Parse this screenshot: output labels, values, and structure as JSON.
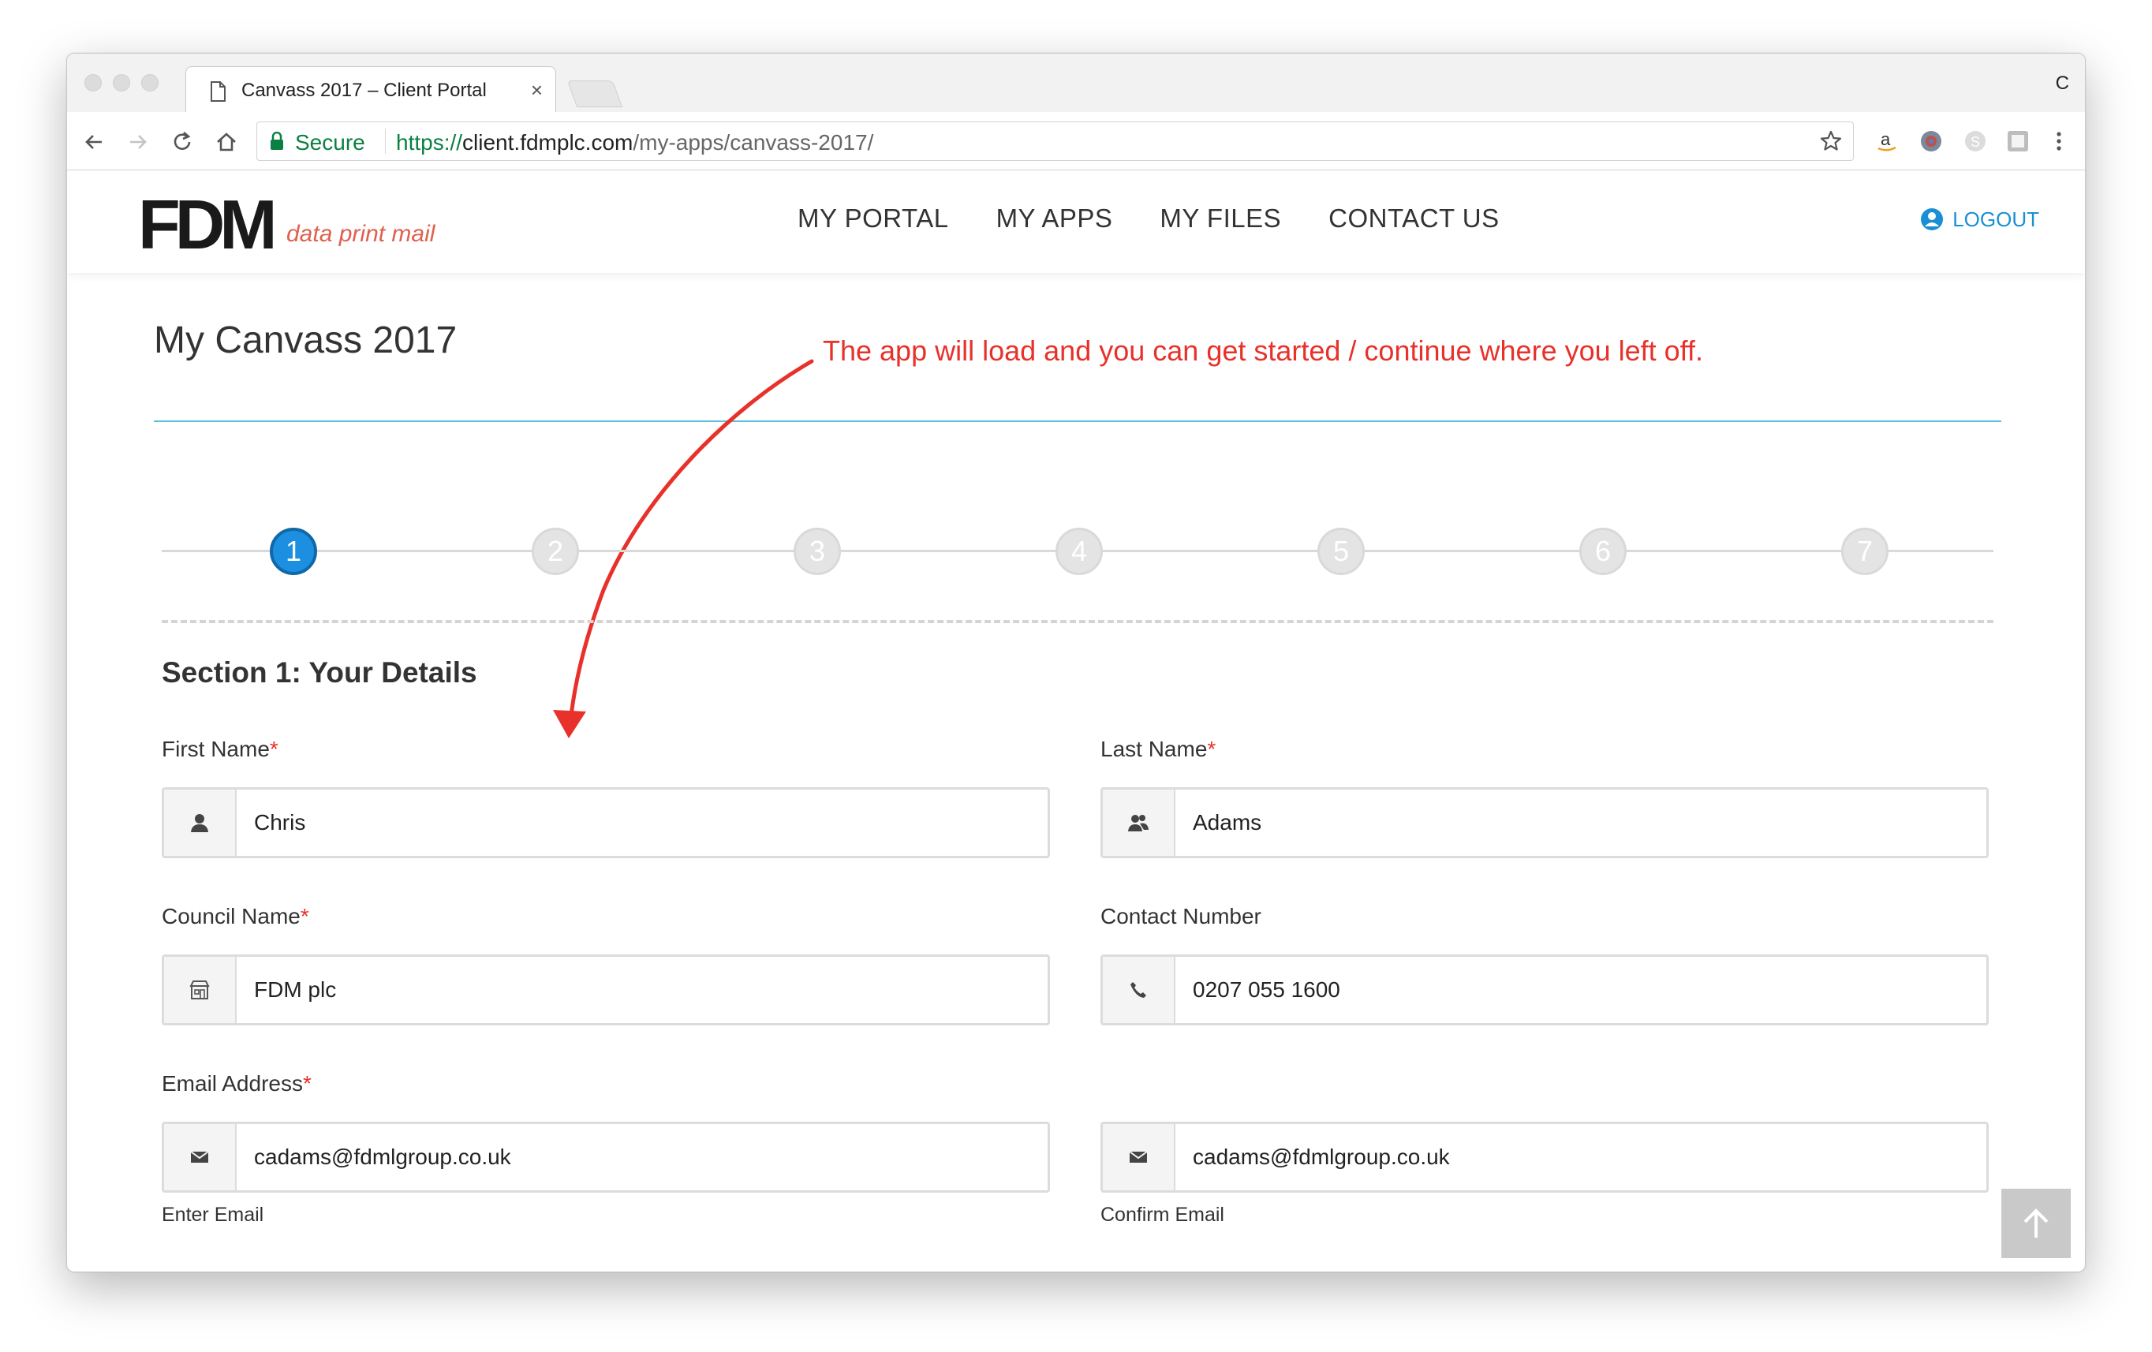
{
  "browser": {
    "tab_title": "Canvass 2017 – Client Portal",
    "tab_close": "×",
    "title_letter": "C",
    "secure_label": "Secure",
    "url_scheme": "https://",
    "url_host": "client.fdmplc.com",
    "url_path": "/my-apps/canvass-2017/"
  },
  "header": {
    "logo_main": "FDM",
    "logo_tagline": "data print mail",
    "nav": [
      "MY PORTAL",
      "MY APPS",
      "MY FILES",
      "CONTACT US"
    ],
    "logout_label": "LOGOUT"
  },
  "page": {
    "title": "My Canvass 2017",
    "annotation": "The app will load and you can get started / continue where you left off."
  },
  "stepper": {
    "steps": [
      "1",
      "2",
      "3",
      "4",
      "5",
      "6",
      "7"
    ],
    "active_step": 1
  },
  "form": {
    "section_title": "Section 1: Your Details",
    "required_mark": "*",
    "first_name": {
      "label": "First Name",
      "value": "Chris",
      "icon": "user-icon"
    },
    "last_name": {
      "label": "Last Name",
      "value": "Adams",
      "icon": "users-icon"
    },
    "council_name": {
      "label": "Council Name",
      "value": "FDM plc",
      "icon": "building-icon"
    },
    "contact_number": {
      "label": "Contact Number",
      "value": "0207 055 1600",
      "icon": "phone-icon"
    },
    "email_label": "Email Address",
    "email": {
      "value": "cadams@fdmlgroup.co.uk",
      "helper": "Enter Email",
      "icon": "envelope-icon"
    },
    "confirm_email": {
      "value": "cadams@fdmlgroup.co.uk",
      "helper": "Confirm Email",
      "icon": "envelope-icon"
    }
  },
  "colors": {
    "accent_blue": "#1d8fe0",
    "annotation_red": "#e8312a",
    "rule_teal": "#5cc0dc",
    "secure_green": "#0b8043"
  }
}
